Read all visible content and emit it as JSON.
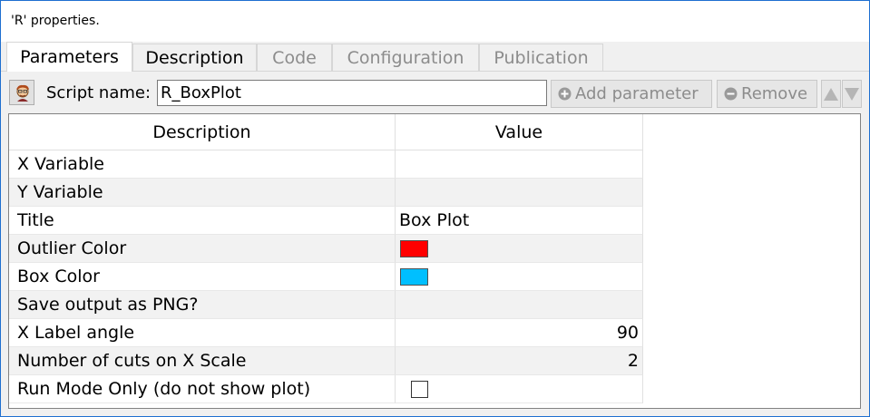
{
  "window": {
    "title": "'R' properties."
  },
  "tabs": [
    {
      "label": "Parameters",
      "active": true
    },
    {
      "label": "Description",
      "active": false
    },
    {
      "label": "Code",
      "active": false
    },
    {
      "label": "Configuration",
      "active": false
    },
    {
      "label": "Publication",
      "active": false
    }
  ],
  "toolbar": {
    "script_name_label": "Script name:",
    "script_name_value": "R_BoxPlot",
    "add_parameter_label": "Add parameter",
    "remove_label": "Remove"
  },
  "table": {
    "headers": {
      "description": "Description",
      "value": "Value"
    },
    "rows": [
      {
        "description": "X Variable",
        "value": ""
      },
      {
        "description": "Y Variable",
        "value": ""
      },
      {
        "description": "Title",
        "value": "Box Plot"
      },
      {
        "description": "Outlier Color",
        "value": "",
        "color": "#ff0000"
      },
      {
        "description": "Box Color",
        "value": "",
        "color": "#00bfff"
      },
      {
        "description": "Save output as PNG?",
        "value": ""
      },
      {
        "description": "X Label angle",
        "value": "90"
      },
      {
        "description": "Number of cuts on X Scale",
        "value": "2"
      },
      {
        "description": "Run Mode Only (do not show plot)",
        "value": "",
        "checked": false
      }
    ]
  },
  "colors": {
    "accent_border": "#1e6fd0"
  },
  "icons": {
    "script": "r-script-icon",
    "add": "plus-circle-icon",
    "remove": "minus-circle-icon",
    "up": "arrow-up-icon",
    "down": "arrow-down-icon"
  }
}
